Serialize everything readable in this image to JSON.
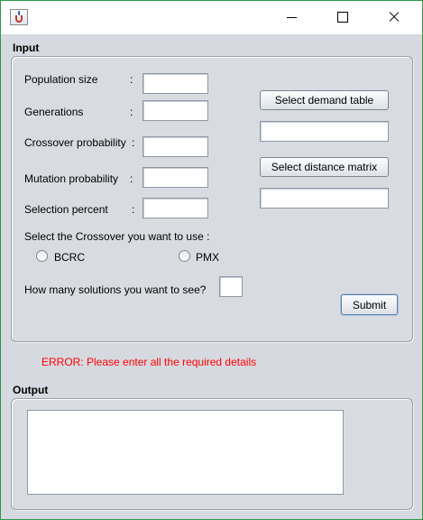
{
  "window": {
    "title": ""
  },
  "input": {
    "section_title": "Input",
    "fields": [
      {
        "label": "Population size",
        "colon": ":",
        "value": ""
      },
      {
        "label": "Generations",
        "colon": ":",
        "value": ""
      },
      {
        "label": "Crossover probability",
        "colon": ":",
        "value": ""
      },
      {
        "label": "Mutation probability",
        "colon": ":",
        "value": ""
      },
      {
        "label": "Selection percent",
        "colon": ":",
        "value": ""
      }
    ],
    "demand_button": "Select demand table",
    "demand_value": "",
    "distance_button": "Select distance matrix",
    "distance_value": "",
    "crossover_prompt": "Select the Crossover you want to use :",
    "crossover_options": [
      "BCRC",
      "PMX"
    ],
    "solutions_prompt": "How many solutions you want to see?",
    "solutions_value": "",
    "submit_label": "Submit"
  },
  "error_message": "ERROR: Please enter all the required details",
  "output": {
    "section_title": "Output",
    "text": ""
  },
  "colors": {
    "error": "#ff0000",
    "window_border": "#2a9a4a",
    "panel_bg": "#d6d9df"
  }
}
